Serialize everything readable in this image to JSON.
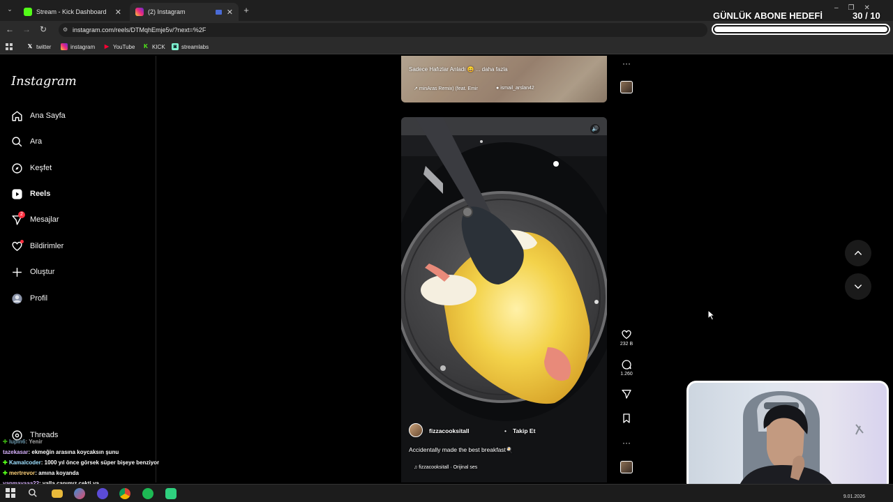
{
  "browser": {
    "tabs": [
      {
        "title": "Stream - Kick Dashboard",
        "active": false
      },
      {
        "title": "(2) Instagram",
        "active": true
      }
    ],
    "new_tab": "+",
    "url": "instagram.com/reels/DTMqhEmje5v/?next=%2F",
    "bookmarks": [
      {
        "label": "twitter",
        "icon": "x-icon"
      },
      {
        "label": "instagram",
        "icon": "instagram-icon"
      },
      {
        "label": "YouTube",
        "icon": "youtube-icon"
      },
      {
        "label": "KICK",
        "icon": "kick-icon"
      },
      {
        "label": "streamlabs",
        "icon": "streamlabs-icon"
      }
    ]
  },
  "goal": {
    "title": "GÜNLÜK ABONE HEDEFİ",
    "count": "30  / 10",
    "progress": 1.0
  },
  "sidebar": {
    "logo": "Instagram",
    "items": [
      {
        "label": "Ana Sayfa",
        "icon": "home-icon"
      },
      {
        "label": "Ara",
        "icon": "search-icon"
      },
      {
        "label": "Keşfet",
        "icon": "compass-icon"
      },
      {
        "label": "Reels",
        "icon": "reels-icon",
        "active": true
      },
      {
        "label": "Mesajlar",
        "icon": "messenger-icon",
        "badge": "2"
      },
      {
        "label": "Bildirimler",
        "icon": "heart-icon",
        "dot": true
      },
      {
        "label": "Oluştur",
        "icon": "plus-icon"
      },
      {
        "label": "Profil",
        "icon": "avatar-icon"
      }
    ],
    "threads": "Threads"
  },
  "reel_prev": {
    "caption": "Sadece Hafızlar Anladı 😄 ... daha fazla",
    "audio": "minAras Remix) (feat. Emir",
    "tagged": "ismail_arslan42"
  },
  "reel_main": {
    "username": "fizzacooksitall",
    "follow": "Takip Et",
    "separator": "•",
    "caption": "Accidentally made the best breakfast🍳",
    "audio": "fizzacooksitall · Orijinal ses",
    "likes": "232 B",
    "comments": "1.260"
  },
  "chat": [
    {
      "user": "lupin6",
      "text": ": Yenir"
    },
    {
      "user": "tazekasar",
      "text": ": ekmeğin arasına koycaksın şunu"
    },
    {
      "user": "Kamalcoder",
      "text": ": 1000 yıl önce görsek süper bişeye benziyor"
    },
    {
      "user": "mertrevor",
      "text": ": amına koyanda"
    },
    {
      "user": "yapmayaaa22",
      "text": ": valla canımız çekti ya"
    }
  ],
  "taskbar": {
    "date": "9.01.2026"
  },
  "colors": {
    "background": "#000000",
    "notification": "#ff3040",
    "egg": "#f2c230",
    "pan": "#4a4a4c"
  }
}
